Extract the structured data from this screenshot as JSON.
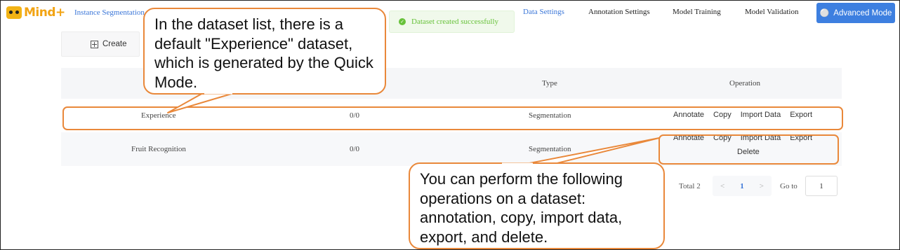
{
  "header": {
    "logo_text": "Mind+",
    "breadcrumb": "Instance Segmentation",
    "nav": [
      "Data Settings",
      "Annotation Settings",
      "Model Training",
      "Model Validation"
    ],
    "advanced_mode": "Advanced Mode",
    "advanced_icon": "person-icon"
  },
  "toast": {
    "message": "Dataset created successfully",
    "icon": "check-circle-icon",
    "color": "#67c23a"
  },
  "toolbar": {
    "create_label": "Create",
    "create_icon": "plus-square-icon"
  },
  "table": {
    "headers": {
      "type": "Type",
      "operation": "Operation"
    },
    "rows": [
      {
        "name": "Experience",
        "count": "0/0",
        "type": "Segmentation",
        "ops": [
          "Annotate",
          "Copy",
          "Import Data",
          "Export"
        ]
      },
      {
        "name": "Fruit Recognition",
        "count": "0/0",
        "type": "Segmentation",
        "ops": [
          "Annotate",
          "Copy",
          "Import Data",
          "Export"
        ],
        "ops2": [
          "Delete"
        ]
      }
    ]
  },
  "pagination": {
    "total": "Total 2",
    "prev": "<",
    "page": "1",
    "next": ">",
    "goto_label": "Go to",
    "goto_value": "1"
  },
  "callouts": {
    "top": "In the dataset list, there is a default \"Experience\" dataset, which is generated by the Quick Mode.",
    "bottom": "You can perform the following operations on a dataset: annotation, copy, import data, export, and delete."
  },
  "colors": {
    "accent": "#3a76d8",
    "button": "#3d7fe0",
    "highlight": "#e9883a",
    "logo": "#f2a312"
  }
}
